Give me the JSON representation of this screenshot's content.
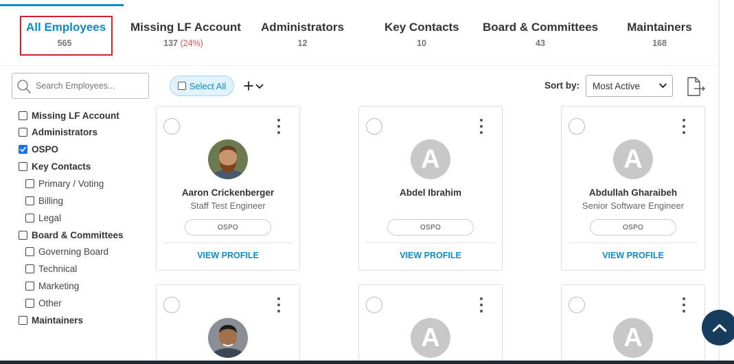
{
  "tabs": [
    {
      "label": "All Employees",
      "count": "565",
      "pct": "",
      "active": true
    },
    {
      "label": "Missing LF Account",
      "count": "137",
      "pct": "(24%)"
    },
    {
      "label": "Administrators",
      "count": "12",
      "pct": ""
    },
    {
      "label": "Key Contacts",
      "count": "10",
      "pct": ""
    },
    {
      "label": "Board & Committees",
      "count": "43",
      "pct": ""
    },
    {
      "label": "Maintainers",
      "count": "168",
      "pct": ""
    }
  ],
  "search": {
    "placeholder": "Search Employees..."
  },
  "filters": [
    {
      "label": "Missing LF Account",
      "checked": false,
      "level": "main"
    },
    {
      "label": "Administrators",
      "checked": false,
      "level": "main"
    },
    {
      "label": "OSPO",
      "checked": true,
      "level": "main"
    },
    {
      "label": "Key Contacts",
      "checked": false,
      "level": "main"
    },
    {
      "label": "Primary / Voting",
      "checked": false,
      "level": "sub"
    },
    {
      "label": "Billing",
      "checked": false,
      "level": "sub"
    },
    {
      "label": "Legal",
      "checked": false,
      "level": "sub"
    },
    {
      "label": "Board & Committees",
      "checked": false,
      "level": "main"
    },
    {
      "label": "Governing Board",
      "checked": false,
      "level": "sub"
    },
    {
      "label": "Technical",
      "checked": false,
      "level": "sub"
    },
    {
      "label": "Marketing",
      "checked": false,
      "level": "sub"
    },
    {
      "label": "Other",
      "checked": false,
      "level": "sub"
    },
    {
      "label": "Maintainers",
      "checked": false,
      "level": "main"
    }
  ],
  "toolbar": {
    "select_all_label": "Select All",
    "sort_label": "Sort by:",
    "sort_value": "Most Active"
  },
  "cards": [
    {
      "name": "Aaron Crickenberger",
      "title": "Staff Test Engineer",
      "badge": "OSPO",
      "view_label": "VIEW PROFILE",
      "avatar": "photo"
    },
    {
      "name": "Abdel Ibrahim",
      "title": "",
      "badge": "OSPO",
      "view_label": "VIEW PROFILE",
      "avatar": "A"
    },
    {
      "name": "Abdullah Gharaibeh",
      "title": "Senior Software Engineer",
      "badge": "OSPO",
      "view_label": "VIEW PROFILE",
      "avatar": "A"
    },
    {
      "name": "",
      "title": "",
      "badge": "",
      "view_label": "",
      "avatar": "photo"
    },
    {
      "name": "",
      "title": "",
      "badge": "",
      "view_label": "",
      "avatar": "A"
    },
    {
      "name": "",
      "title": "",
      "badge": "",
      "view_label": "",
      "avatar": "A"
    }
  ],
  "colors": {
    "accent": "#0e8ac7",
    "highlight_box": "#d92128",
    "percent": "#e05252",
    "scroll_button": "#173d5c"
  }
}
